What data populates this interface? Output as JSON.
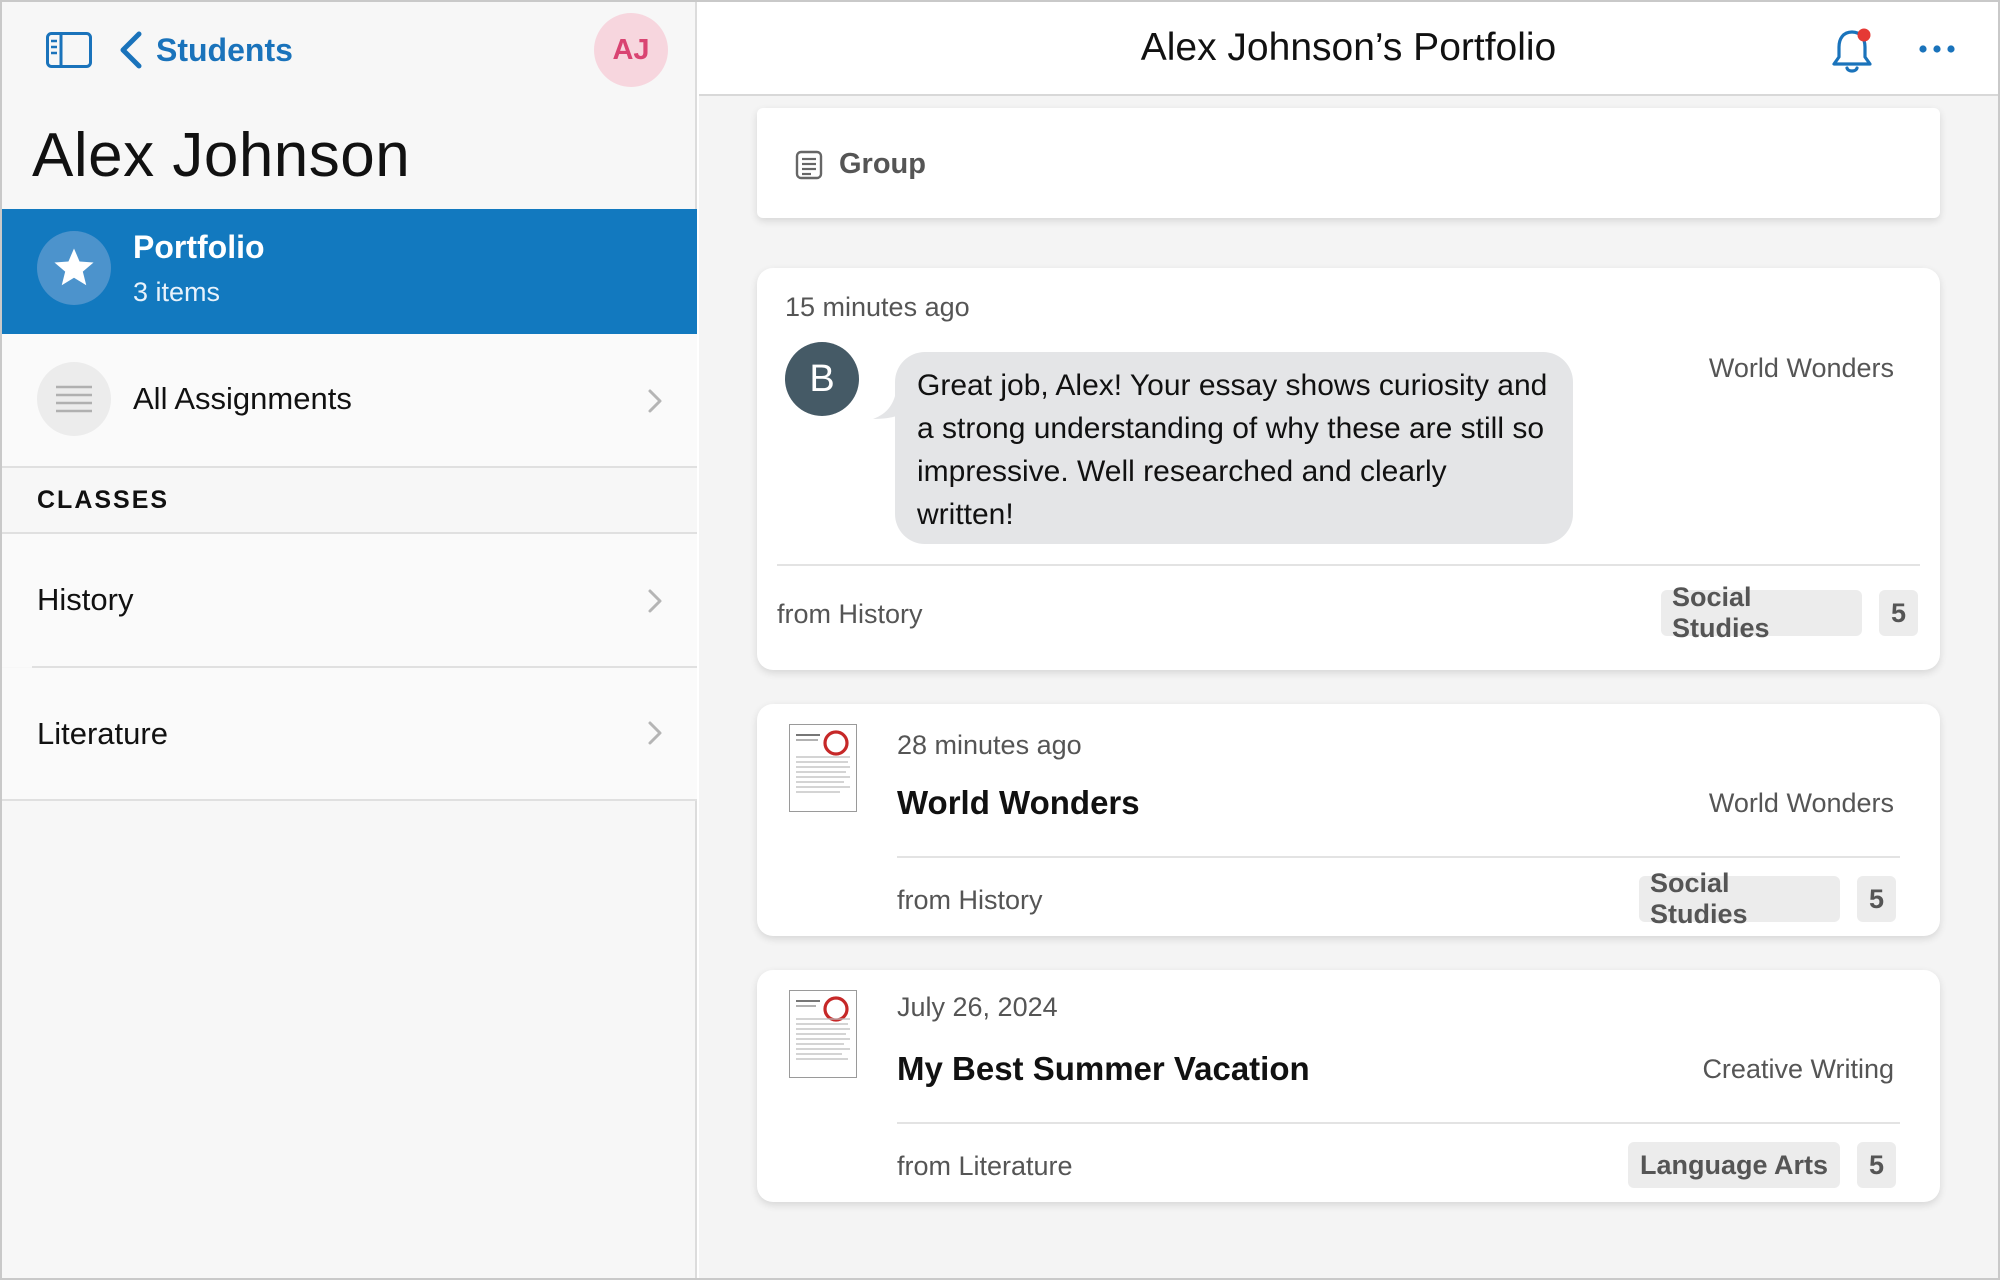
{
  "sidebar": {
    "back_label": "Students",
    "avatar_initials": "AJ",
    "student_name": "Alex Johnson",
    "portfolio": {
      "title": "Portfolio",
      "subtitle": "3 items"
    },
    "all_assignments": "All Assignments",
    "classes_header": "CLASSES",
    "classes": [
      {
        "label": "History"
      },
      {
        "label": "Literature"
      }
    ]
  },
  "header": {
    "title": "Alex Johnson’s Portfolio",
    "notification_dot": true
  },
  "feed": {
    "group_label": "Group",
    "items": [
      {
        "type": "comment",
        "timestamp": "15 minutes ago",
        "avatar_letter": "B",
        "comment": "Great job, Alex! Your essay shows curiosity and a strong understanding of why these are still so impressive. Well researched and clearly written!",
        "class_name": "World Wonders",
        "from": "from History",
        "tag": "Social Studies",
        "count": "5"
      },
      {
        "type": "work",
        "timestamp": "28 minutes ago",
        "title": "World Wonders",
        "class_name": "World Wonders",
        "from": "from History",
        "tag": "Social Studies",
        "count": "5"
      },
      {
        "type": "work",
        "timestamp": "July 26, 2024",
        "title": "My Best Summer Vacation",
        "class_name": "Creative Writing",
        "from": "from Literature",
        "tag": "Language Arts",
        "count": "5"
      }
    ]
  },
  "colors": {
    "accent": "#1279bf",
    "link": "#1a73bb",
    "avatar_bg": "#f7d6de",
    "avatar_text": "#d94472",
    "notification_dot": "#e53935"
  },
  "icons": [
    "sidebar-toggle-icon",
    "chevron-left-icon",
    "star-icon",
    "list-icon",
    "chevron-right-icon",
    "bell-icon",
    "more-icon",
    "document-icon"
  ]
}
